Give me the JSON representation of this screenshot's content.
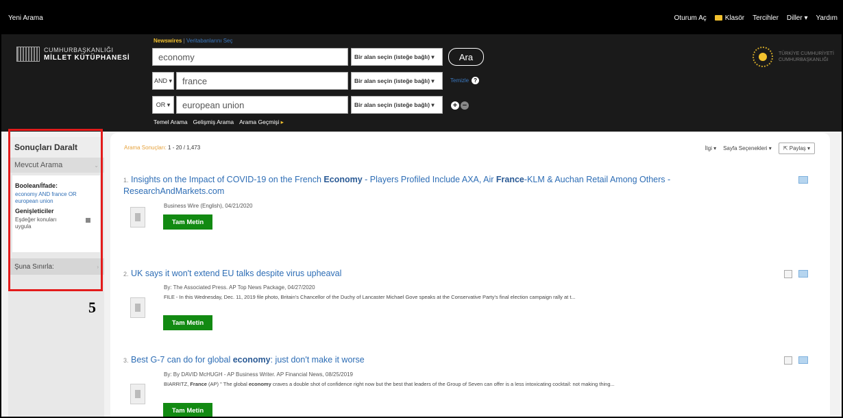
{
  "topbar": {
    "new_search": "Yeni Arama",
    "nav": [
      "Oturum Aç",
      "Klasör",
      "Tercihler",
      "Diller ▾",
      "Yardım"
    ]
  },
  "logo": {
    "line1": "CUMHURBAŞKANLIĞI",
    "line2": "MİLLET KÜTÜPHANESİ"
  },
  "emblem": {
    "line1": "TÜRKİYE CUMHURİYETİ",
    "line2": "CUMHURBAŞKANLIĞI"
  },
  "search": {
    "database": "Newswires",
    "separator": "|",
    "choose_db": "Veritabanlarını Seç",
    "rows": [
      {
        "bool": "",
        "term": "economy",
        "field": "Bir alan seçin (isteğe bağlı) ▾"
      },
      {
        "bool": "AND ▾",
        "term": "france",
        "field": "Bir alan seçin (isteğe bağlı) ▾"
      },
      {
        "bool": "OR ▾",
        "term": "european union",
        "field": "Bir alan seçin (isteğe bağlı) ▾"
      }
    ],
    "search_button": "Ara",
    "clear": "Temizle",
    "help": "?",
    "plus": "+",
    "minus": "−",
    "modes": [
      "Temel Arama",
      "Gelişmiş Arama",
      "Arama Geçmişi"
    ],
    "modes_arrow": "▸"
  },
  "sidebar": {
    "title": "Sonuçları Daralt",
    "current": "Mevcut Arama",
    "boolean_label": "Boolean/İfade:",
    "boolean_value": "economy AND france OR european union",
    "expanders_label": "Genişleticiler",
    "expander": "Eşdeğer konuları uygula",
    "limit": "Şuna Sınırla:",
    "chevron_down": "⌄",
    "chevron_right": "›"
  },
  "annotation": {
    "label": "5",
    "color": "#e31b1b"
  },
  "results": {
    "count_label": "Arama Sonuçları:",
    "count": "1 - 20 / 1,473",
    "sort": "İlgi ▾",
    "page_options": "Sayfa Seçenekleri ▾",
    "share": "Paylaş ▾",
    "full_text_button": "Tam Metin",
    "items": [
      {
        "num": "1.",
        "title_parts": [
          {
            "t": "Insights on the Impact of COVID-19 on the French "
          },
          {
            "t": "Economy",
            "b": true
          },
          {
            "t": " - Players Profiled Include AXA, Air "
          },
          {
            "t": "France",
            "b": true
          },
          {
            "t": "-KLM & Auchan Retail Among Others - ResearchAndMarkets.com"
          }
        ],
        "source": "Business Wire (English), 04/21/2020",
        "snippet": ""
      },
      {
        "num": "2.",
        "title_parts": [
          {
            "t": "UK says it won't extend EU talks despite virus upheaval"
          }
        ],
        "source": "By: The Associated Press. AP Top News Package, 04/27/2020",
        "snippet": "FILE - In this Wednesday, Dec. 11, 2019 file photo, Britain's Chancellor of the Duchy of Lancaster Michael Gove speaks at the Conservative Party's final election campaign rally at t..."
      },
      {
        "num": "3.",
        "title_parts": [
          {
            "t": "Best G-7 can do for global "
          },
          {
            "t": "economy",
            "b": true
          },
          {
            "t": ": just don't make it worse"
          }
        ],
        "source": "By: By DAVID McHUGH - AP Business Writer. AP Financial News, 08/25/2019",
        "snippet_parts": [
          {
            "t": "BIARRITZ, "
          },
          {
            "t": "France",
            "b": true
          },
          {
            "t": " (AP) \" The global "
          },
          {
            "t": "economy",
            "b": true
          },
          {
            "t": " craves a double shot of confidence right now but the best that leaders of the Group of Seven can offer is a less intoxicating cocktail: not making thing..."
          }
        ]
      }
    ]
  }
}
